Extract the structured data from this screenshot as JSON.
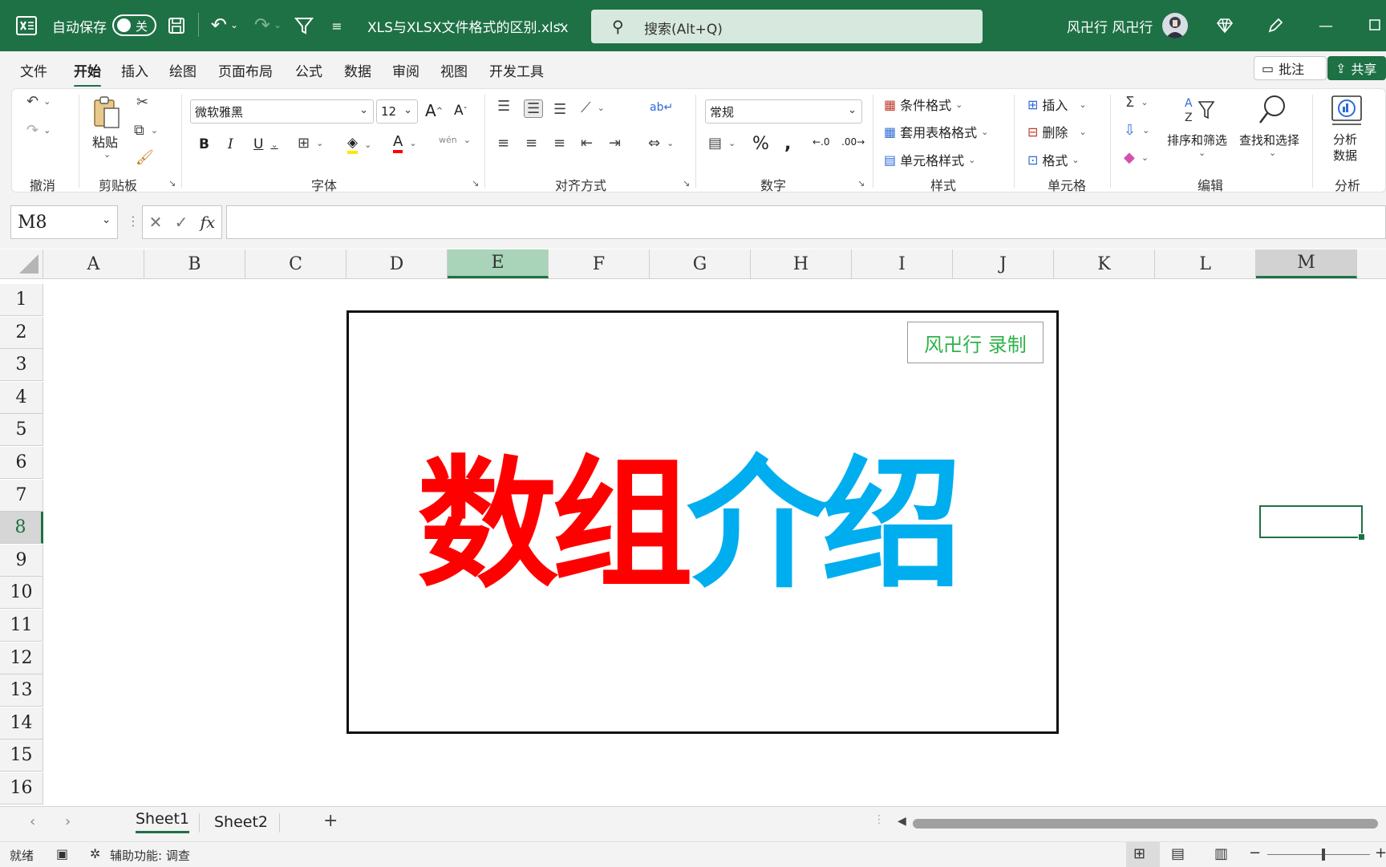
{
  "titlebar": {
    "autosave_label": "自动保存",
    "autosave_state": "关",
    "filename": "XLS与XLSX文件格式的区别.xlsx",
    "search_placeholder": "搜索(Alt+Q)",
    "username": "风卍行 风卍行"
  },
  "menu": {
    "tabs": [
      "文件",
      "开始",
      "插入",
      "绘图",
      "页面布局",
      "公式",
      "数据",
      "审阅",
      "视图",
      "开发工具"
    ],
    "comment_label": "批注",
    "share_label": "共享"
  },
  "ribbon": {
    "groups": {
      "undo": "撤消",
      "clipboard": "剪贴板",
      "font": "字体",
      "alignment": "对齐方式",
      "number": "数字",
      "styles": "样式",
      "cells": "单元格",
      "editing": "编辑",
      "analysis": "分析"
    },
    "paste_label": "粘贴",
    "font_name": "微软雅黑",
    "font_size": "12",
    "number_format": "常规",
    "conditional_format": "条件格式",
    "table_format": "套用表格格式",
    "cell_styles": "单元格样式",
    "insert_label": "插入",
    "delete_label": "删除",
    "format_label": "格式",
    "sort_filter": "排序和筛选",
    "find_select": "查找和选择",
    "analyze_line1": "分析",
    "analyze_line2": "数据"
  },
  "formula_bar": {
    "name_box": "M8",
    "fx": "fx",
    "content": ""
  },
  "grid": {
    "columns": [
      "A",
      "B",
      "C",
      "D",
      "E",
      "F",
      "G",
      "H",
      "I",
      "J",
      "K",
      "L",
      "M"
    ],
    "rows": [
      "1",
      "2",
      "3",
      "4",
      "5",
      "6",
      "7",
      "8",
      "9",
      "10",
      "11",
      "12",
      "13",
      "14",
      "15",
      "16"
    ],
    "highlight_column": "E",
    "selected_column": "M",
    "selected_row": "8"
  },
  "picture": {
    "watermark": "风卍行 录制",
    "title_red": "数组",
    "title_blue": "介绍",
    "colors": {
      "red": "#ff0000",
      "blue": "#00aeef"
    }
  },
  "sheets": {
    "tabs": [
      "Sheet1",
      "Sheet2"
    ],
    "active": "Sheet1"
  },
  "status": {
    "ready": "就绪",
    "accessibility": "辅助功能: 调查"
  },
  "colors": {
    "accent": "#1e7145"
  }
}
